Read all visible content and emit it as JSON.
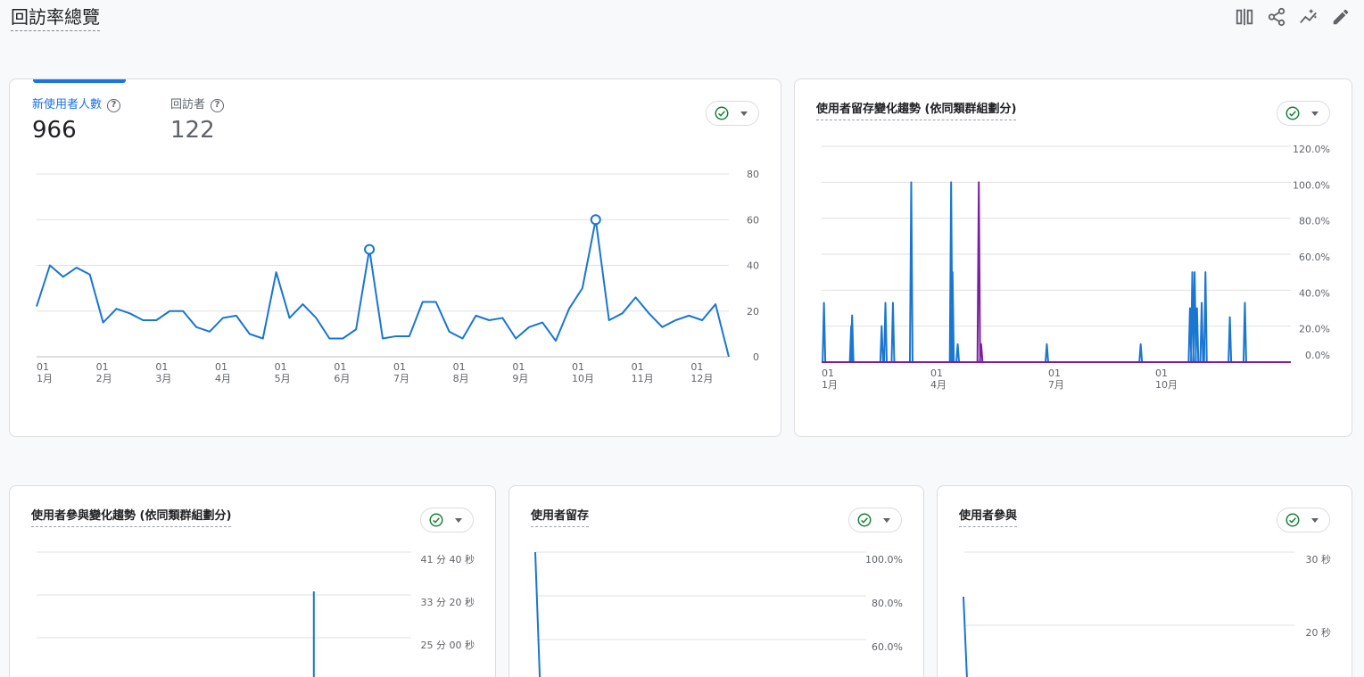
{
  "page": {
    "title": "回訪率總覽"
  },
  "toolbar": {
    "compare_icon": "compare-icon",
    "share_icon": "share-icon",
    "insights_icon": "insights-icon",
    "edit_icon": "edit-icon"
  },
  "colors": {
    "accent": "#1a73e8",
    "line": "#1976d2",
    "purple": "#7b1fa2",
    "success": "#188038"
  },
  "overview_card": {
    "metrics": [
      {
        "label": "新使用者人數",
        "value": "966"
      },
      {
        "label": "回訪者",
        "value": "122"
      }
    ],
    "chart_data": {
      "type": "line",
      "ylim": [
        0,
        80
      ],
      "y_ticks": [
        "80",
        "60",
        "40",
        "20",
        "0"
      ],
      "x_tick_labels": [
        {
          "day": "01",
          "month": "1月"
        },
        {
          "day": "01",
          "month": "2月"
        },
        {
          "day": "01",
          "month": "3月"
        },
        {
          "day": "01",
          "month": "4月"
        },
        {
          "day": "01",
          "month": "5月"
        },
        {
          "day": "01",
          "month": "6月"
        },
        {
          "day": "01",
          "month": "7月"
        },
        {
          "day": "01",
          "month": "8月"
        },
        {
          "day": "01",
          "month": "9月"
        },
        {
          "day": "01",
          "month": "10月"
        },
        {
          "day": "01",
          "month": "11月"
        },
        {
          "day": "01",
          "month": "12月"
        }
      ],
      "series": [
        {
          "values": [
            22,
            40,
            35,
            39,
            36,
            15,
            21,
            19,
            16,
            16,
            20,
            20,
            13,
            11,
            17,
            18,
            10,
            8,
            37,
            17,
            23,
            17,
            8,
            8,
            12,
            47,
            8,
            9,
            9,
            24,
            24,
            11,
            8,
            18,
            16,
            17,
            8,
            13,
            15,
            7,
            21,
            30,
            60,
            16,
            19,
            26,
            19,
            13,
            16,
            18,
            16,
            23,
            0
          ]
        }
      ],
      "highlight_points": [
        25,
        42
      ]
    }
  },
  "retention_trend_card": {
    "title": "使用者留存變化趨勢 (依同類群組劃分)",
    "chart_data": {
      "type": "line",
      "ylim": [
        0,
        120
      ],
      "y_ticks": [
        "120.0%",
        "100.0%",
        "80.0%",
        "60.0%",
        "40.0%",
        "20.0%",
        "0.0%"
      ],
      "x_tick_labels": [
        {
          "day": "01",
          "month": "1月"
        },
        {
          "day": "01",
          "month": "4月"
        },
        {
          "day": "01",
          "month": "7月"
        },
        {
          "day": "01",
          "month": "10月"
        }
      ],
      "series": [
        {
          "color": "#1976d2",
          "spikes": [
            [
              0.005,
              33
            ],
            [
              0.063,
              20
            ],
            [
              0.065,
              26
            ],
            [
              0.128,
              20
            ],
            [
              0.136,
              33
            ],
            [
              0.152,
              33
            ],
            [
              0.191,
              100
            ],
            [
              0.276,
              100
            ],
            [
              0.279,
              50
            ],
            [
              0.29,
              10
            ],
            [
              0.48,
              10
            ],
            [
              0.68,
              10
            ],
            [
              0.785,
              30
            ],
            [
              0.79,
              50
            ],
            [
              0.795,
              50
            ],
            [
              0.8,
              30
            ],
            [
              0.81,
              33
            ],
            [
              0.818,
              50
            ],
            [
              0.87,
              25
            ],
            [
              0.902,
              33
            ]
          ]
        },
        {
          "color": "#7b1fa2",
          "spikes": [
            [
              0.335,
              100
            ],
            [
              0.34,
              10
            ]
          ]
        }
      ]
    }
  },
  "engagement_trend_card": {
    "title": "使用者參與變化趨勢 (依同類群組劃分)",
    "chart_data": {
      "type": "line",
      "y_ticks": [
        "41 分 40 秒",
        "33 分 20 秒",
        "25 分 00 秒"
      ],
      "spike_frac": 0.74
    }
  },
  "retention_card": {
    "title": "使用者留存",
    "chart_data": {
      "type": "line",
      "y_ticks": [
        "100.0%",
        "80.0%",
        "60.0%"
      ]
    }
  },
  "engagement_card": {
    "title": "使用者參與",
    "chart_data": {
      "type": "line",
      "y_ticks": [
        "30 秒",
        "20 秒"
      ]
    }
  }
}
